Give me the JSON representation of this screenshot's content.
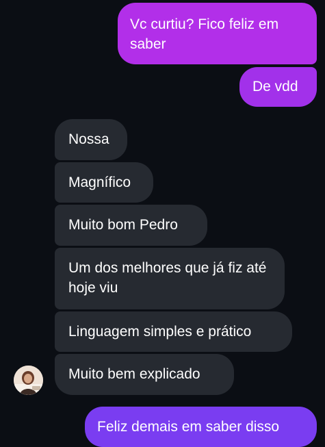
{
  "conversation": {
    "messages": [
      {
        "direction": "outgoing",
        "text": "Vc curtiu? Fico feliz em saber"
      },
      {
        "direction": "outgoing",
        "text": "De vdd"
      },
      {
        "direction": "incoming",
        "text": "Nossa"
      },
      {
        "direction": "incoming",
        "text": "Magnífico"
      },
      {
        "direction": "incoming",
        "text": "Muito bom Pedro"
      },
      {
        "direction": "incoming",
        "text": "Um dos melhores que já fiz até hoje viu"
      },
      {
        "direction": "incoming",
        "text": "Linguagem simples e prático"
      },
      {
        "direction": "incoming",
        "text": "Muito bem explicado"
      },
      {
        "direction": "outgoing",
        "text": "Feliz demais em saber disso"
      }
    ]
  },
  "colors": {
    "background": "#0b0e14",
    "incoming_bubble": "#262a31",
    "outgoing_top": "#b22fe9",
    "outgoing_bottom": "#7a3df1",
    "text": "#ffffff"
  },
  "icons": {
    "avatar": "contact-avatar-photo"
  }
}
